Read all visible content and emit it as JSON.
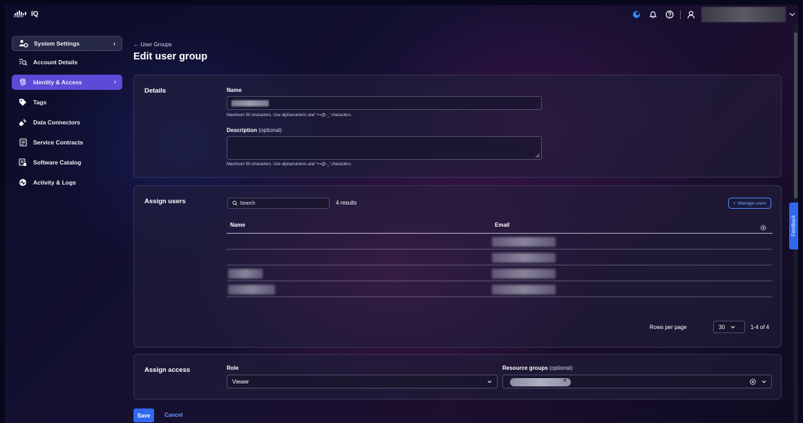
{
  "app": {
    "logo_word": "cisco",
    "name": "IQ"
  },
  "sidebar": {
    "items": [
      {
        "label": "System Settings",
        "icon": "users-gear-icon",
        "state": "header"
      },
      {
        "label": "Account Details",
        "icon": "list-search-icon",
        "state": "normal"
      },
      {
        "label": "Identity & Access",
        "icon": "fingerprint-icon",
        "state": "active"
      },
      {
        "label": "Tags",
        "icon": "tag-icon",
        "state": "normal"
      },
      {
        "label": "Data Connectors",
        "icon": "plug-icon",
        "state": "normal"
      },
      {
        "label": "Service Contracts",
        "icon": "contract-icon",
        "state": "normal"
      },
      {
        "label": "Software Catalog",
        "icon": "catalog-icon",
        "state": "normal"
      },
      {
        "label": "Activity & Logs",
        "icon": "activity-icon",
        "state": "normal"
      }
    ],
    "arrow": "›"
  },
  "page": {
    "back_label": "← User Groups",
    "title": "Edit user group"
  },
  "details": {
    "section_title": "Details",
    "name_label": "Name",
    "name_hint": "Maximum 50 characters. Use alphanumeric and '+=@-_' characters.",
    "description_label": "Description",
    "description_optional": "(optional)",
    "description_hint": "Maximum 50 characters. Use alphanumeric and '+=@-_' characters."
  },
  "assign_users": {
    "section_title": "Assign users",
    "search_placeholder": "Search",
    "results_text": "4 results",
    "manage_button": "Manage users",
    "columns": [
      "Name",
      "Email"
    ],
    "rows_per_page_label": "Rows per page",
    "rows_per_page_value": "30",
    "range_text": "1-4 of 4"
  },
  "assign_access": {
    "section_title": "Assign access",
    "role_label": "Role",
    "role_value": "Viewer",
    "resource_groups_label": "Resource groups",
    "resource_groups_optional": "(optional)"
  },
  "actions": {
    "save": "Save",
    "cancel": "Cancel"
  },
  "feedback_tab": "Feedback",
  "colors": {
    "accent": "#5d4ad9",
    "primary_button": "#2f67ee",
    "link": "#6e9cff"
  }
}
